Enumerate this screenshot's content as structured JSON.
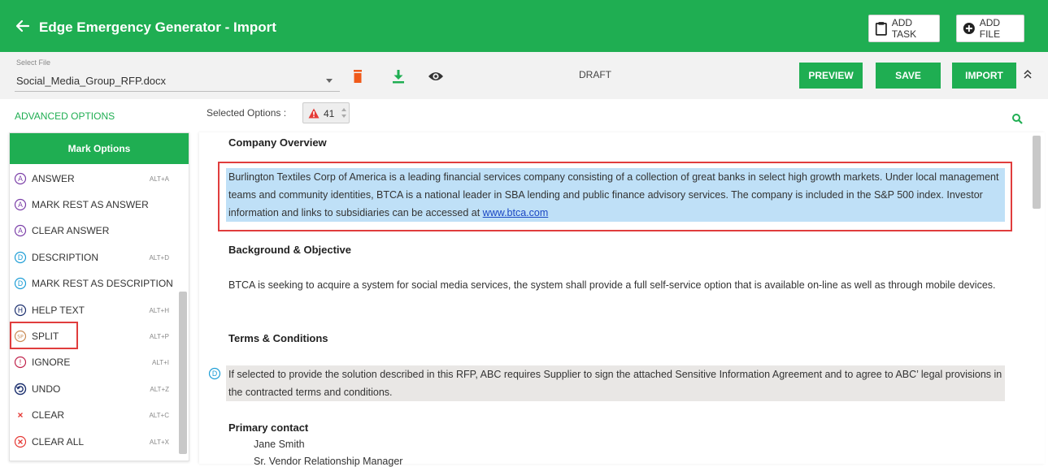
{
  "header": {
    "title": "Edge Emergency Generator - Import",
    "add_task_label": "ADD TASK",
    "add_file_label": "ADD FILE",
    "bg_color": "#1fae52"
  },
  "toolbar": {
    "file_caption": "Select File",
    "file_value": "Social_Media_Group_RFP.docx",
    "status": "DRAFT",
    "preview_label": "PREVIEW",
    "save_label": "SAVE",
    "import_label": "IMPORT"
  },
  "options_bar": {
    "advanced_options": "ADVANCED OPTIONS",
    "selected_options_label": "Selected Options :",
    "selected_count": "41"
  },
  "mark_panel": {
    "title": "Mark Options",
    "items": [
      {
        "label": "ANSWER",
        "shortcut": "ALT+A",
        "icon": "A"
      },
      {
        "label": "MARK REST AS ANSWER",
        "shortcut": "",
        "icon": "A"
      },
      {
        "label": "CLEAR ANSWER",
        "shortcut": "",
        "icon": "A"
      },
      {
        "label": "DESCRIPTION",
        "shortcut": "ALT+D",
        "icon": "D"
      },
      {
        "label": "MARK REST AS DESCRIPTION",
        "shortcut": "",
        "icon": "D"
      },
      {
        "label": "HELP TEXT",
        "shortcut": "ALT+H",
        "icon": "H"
      },
      {
        "label": "SPLIT",
        "shortcut": "ALT+P",
        "icon": "SP"
      },
      {
        "label": "IGNORE",
        "shortcut": "ALT+I",
        "icon": "!"
      },
      {
        "label": "UNDO",
        "shortcut": "ALT+Z",
        "icon": "undo"
      },
      {
        "label": "CLEAR",
        "shortcut": "ALT+C",
        "icon": "x"
      },
      {
        "label": "CLEAR ALL",
        "shortcut": "ALT+X",
        "icon": "X"
      }
    ]
  },
  "document": {
    "company_overview_heading": "Company Overview",
    "company_overview_text": "Burlington Textiles Corp of America is a leading financial services company consisting of a collection of great banks in select high growth markets. Under local management teams and community identities, BTCA is a national leader in SBA lending and public finance advisory services. The company is included in the S&P 500 index. Investor information and links to subsidiaries can be accessed at ",
    "company_link": "www.btca.com",
    "background_heading": "Background & Objective",
    "background_text": "BTCA is seeking to acquire a system for social media services, the system shall provide a full self-service option that is available on-line as well as through mobile devices.",
    "terms_heading": "Terms & Conditions",
    "terms_text": "If selected to provide the solution described in this RFP, ABC requires Supplier to sign the attached Sensitive Information Agreement and to agree to ABC’ legal provisions in the contracted terms and conditions.",
    "terms_marker": "D",
    "primary_contact_heading": "Primary contact",
    "contact_name": "Jane Smith",
    "contact_role": "Sr. Vendor Relationship Manager"
  }
}
